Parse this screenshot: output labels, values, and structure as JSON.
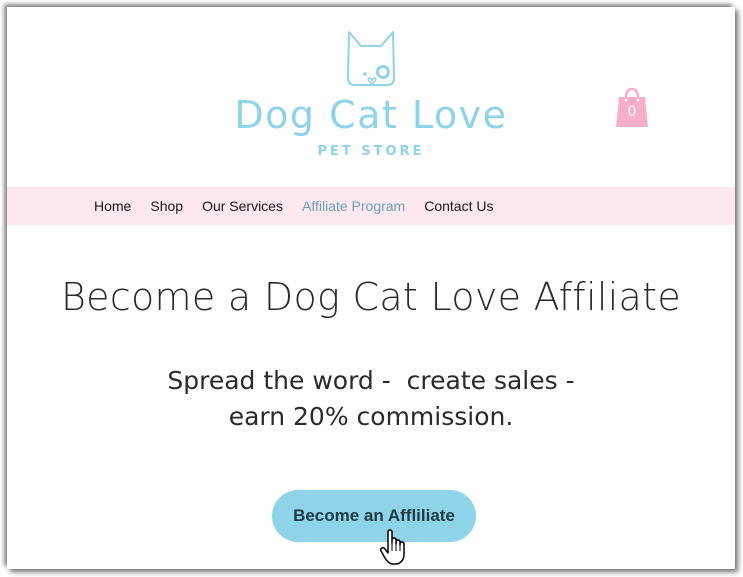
{
  "header": {
    "logo_icon": "dog-cat-face-icon",
    "brand_title": "Dog Cat Love",
    "brand_subtitle": "PET STORE",
    "cart": {
      "icon": "shopping-bag-icon",
      "count": "0"
    }
  },
  "nav": {
    "items": [
      {
        "label": "Home",
        "active": false
      },
      {
        "label": "Shop",
        "active": false
      },
      {
        "label": "Our Services",
        "active": false
      },
      {
        "label": "Affiliate Program",
        "active": true
      },
      {
        "label": "Contact Us",
        "active": false
      }
    ]
  },
  "main": {
    "headline": "Become a Dog Cat Love Affiliate",
    "subline_1": "Spread the word -  create sales -",
    "subline_2": "earn 20% commission.",
    "cta_label": "Become an Affliliate"
  },
  "colors": {
    "brand": "#8fd3ea",
    "nav_bg": "#fce8ee",
    "nav_active": "#6aa3b8",
    "cart": "#f7afc9",
    "button": "#8ed3e8"
  },
  "pointer": "hand-cursor-icon"
}
